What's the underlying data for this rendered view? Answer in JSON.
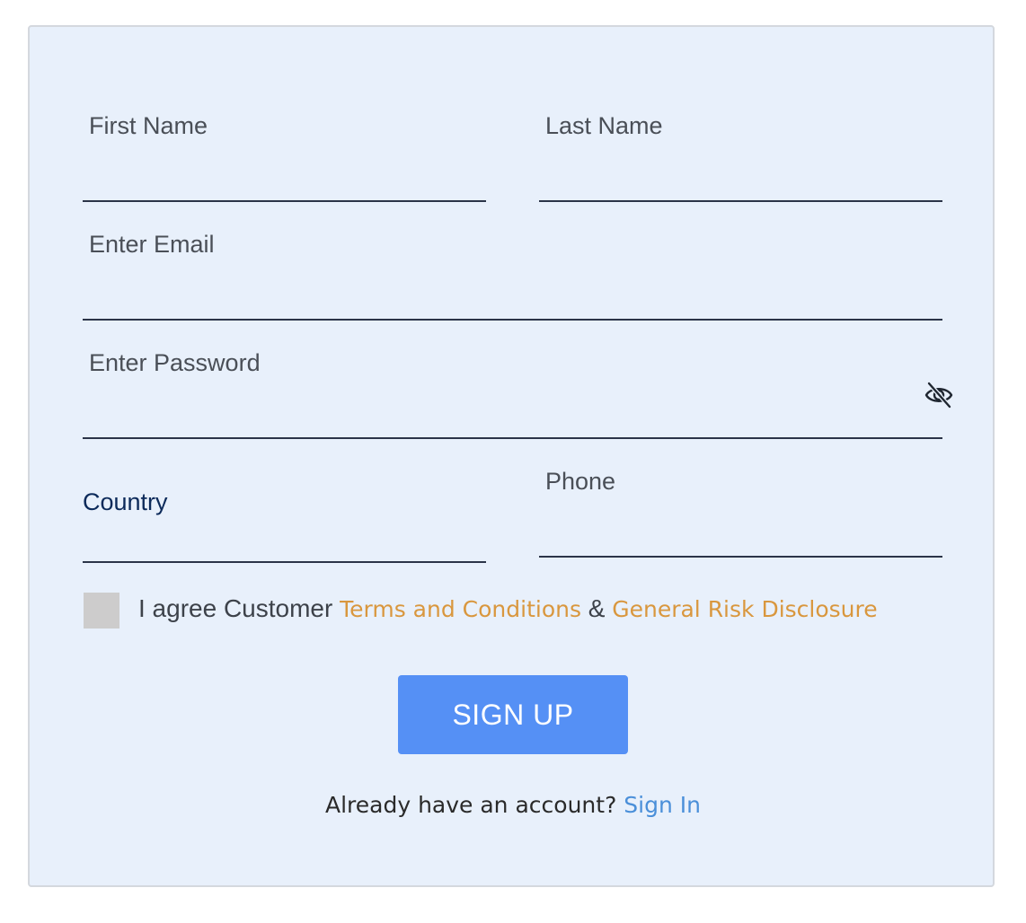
{
  "form": {
    "first_name_label": "First Name",
    "last_name_label": "Last Name",
    "email_label": "Enter Email",
    "password_label": "Enter Password",
    "country_label": "Country",
    "phone_label": "Phone",
    "first_name_value": "",
    "last_name_value": "",
    "email_value": "",
    "password_value": "",
    "country_value": "",
    "phone_value": "",
    "password_toggle_icon": "eye-slash-icon"
  },
  "agreement": {
    "prefix": "I agree Customer ",
    "terms_link": "Terms and Conditions",
    "separator": " & ",
    "risk_link": "General Risk Disclosure",
    "checked": false
  },
  "actions": {
    "signup_label": "SIGN UP"
  },
  "footer": {
    "prompt": "Already have an account? ",
    "signin_link": "Sign In"
  },
  "colors": {
    "card_background": "#e8f0fb",
    "button": "#5590f5",
    "link_orange": "#d9973e",
    "link_blue": "#4a8fd9",
    "country_label": "#0c2a5a"
  }
}
